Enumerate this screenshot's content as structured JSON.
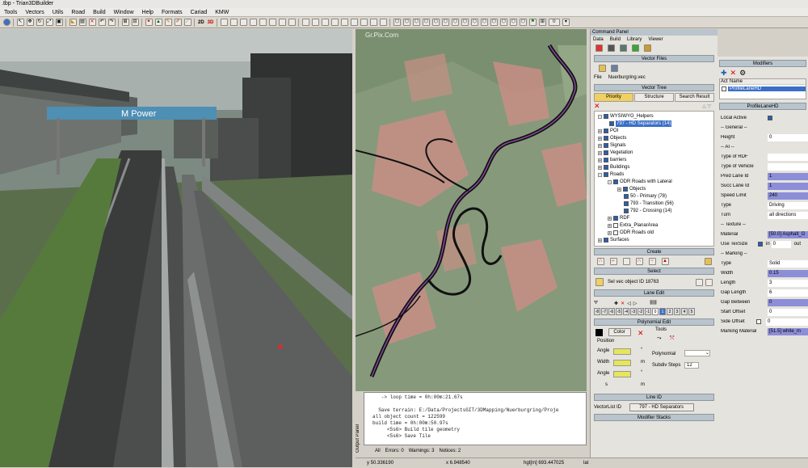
{
  "window": {
    "title": ".tbp - Trian3DBuilder"
  },
  "menu": [
    "Tools",
    "Vectors",
    "Utils",
    "Road",
    "Build",
    "Window",
    "Help",
    "Formats",
    "Cariad",
    "KMW"
  ],
  "toolbar": {
    "btn_2d": "2D",
    "btn_3d": "3D",
    "zoom_value": "0"
  },
  "view3d": {
    "banner": "M Power"
  },
  "map": {
    "corner_label": "Gr.Pix.Corn"
  },
  "output": {
    "lines": [
      "   -> loop time = 0h:00m:21.67s",
      "",
      "  Save terrain: E:/Data/ProjectsGIT/3DMapping/Nuerburgring/Proje",
      "all object count = 122599",
      "build time = 0h:00m:50.97s",
      "     <5s6> Build tile geometry",
      "     <5s6> Save Tile"
    ],
    "panel_label": "Output Panel",
    "tabs": [
      "All",
      "Errors: 0",
      "Warnings: 3",
      "Notices: 2"
    ]
  },
  "status": {
    "y": "y 50.336190",
    "x": "x 6.948540",
    "hgt": "hgt[m] 693.447025",
    "tail": "lat"
  },
  "command_panel": {
    "title": "Command Panel",
    "tabs": [
      "Data",
      "Build",
      "Library",
      "Viewer"
    ],
    "vector_files": {
      "title": "Vector Files",
      "file_label": "File",
      "file_name": "Nuerburgring.vec"
    },
    "vector_tree": {
      "title": "Vector Tree",
      "tabs": [
        "Priority",
        "Structure",
        "Search Result"
      ],
      "items": [
        {
          "label": "WYSIWYG_Helpers",
          "level": 1
        },
        {
          "label": "797 - HD Separators (14)",
          "level": 2,
          "selected": true
        },
        {
          "label": "POI",
          "level": 1
        },
        {
          "label": "Objects",
          "level": 1
        },
        {
          "label": "Signals",
          "level": 1
        },
        {
          "label": "Vegetation",
          "level": 1
        },
        {
          "label": "barriers",
          "level": 1
        },
        {
          "label": "Buildings",
          "level": 1
        },
        {
          "label": "Roads",
          "level": 1
        },
        {
          "label": "ODR Roads with Lateral",
          "level": 2
        },
        {
          "label": "Objects",
          "level": 3
        },
        {
          "label": "50 - Primary (78)",
          "level": 3
        },
        {
          "label": "793 - Transition (56)",
          "level": 3
        },
        {
          "label": "792 - Crossing (14)",
          "level": 3
        },
        {
          "label": "RDF",
          "level": 2
        },
        {
          "label": "Extra_PlanarArea",
          "level": 2
        },
        {
          "label": "ODR Roads old",
          "level": 2
        },
        {
          "label": "Surfaces",
          "level": 1
        }
      ]
    },
    "create": {
      "title": "Create"
    },
    "select": {
      "title": "Select",
      "text": "Sel vec object ID 18763"
    },
    "lane_edit": {
      "title": "Lane Edit",
      "lanes": [
        "-8",
        "-7",
        "-6",
        "-5",
        "-4",
        "-3",
        "-2",
        "-1",
        "0",
        "1",
        "2",
        "3",
        "4",
        "5"
      ],
      "active_lane": "1"
    },
    "polynomial_edit": {
      "title": "Polynomial Edit",
      "color_label": "Color",
      "tools_label": "Tools",
      "position_label": "Position",
      "angle_label": "Angle",
      "width_label": "Width",
      "s_label": "s",
      "unit_deg": "°",
      "unit_m": "m",
      "polynomial_label": "Polynomial",
      "subdiv_label": "Subdiv Steps",
      "subdiv_value": "12"
    },
    "line_id": {
      "title": "Line ID",
      "label": "VectorList ID",
      "value": "797 - HD Separators"
    },
    "modifier_stacks": {
      "title": "Modifier Stacks"
    }
  },
  "modifiers": {
    "title": "Modifiers",
    "col_act": "Act",
    "col_name": "Name",
    "item": "ProfileLaneHD",
    "profile_title": "ProfileLaneHD",
    "props": [
      {
        "label": "Local Active",
        "value": "",
        "type": "check"
      },
      {
        "label": "-- General --",
        "value": "",
        "type": "header"
      },
      {
        "label": "Height",
        "value": "0",
        "type": "w"
      },
      {
        "label": "-- AI --",
        "value": "",
        "type": "header"
      },
      {
        "label": "Type of RDF",
        "value": "",
        "type": "w"
      },
      {
        "label": "Type of Vehicle",
        "value": "",
        "type": "w"
      },
      {
        "label": "Pred Lane Id",
        "value": "1",
        "type": "b"
      },
      {
        "label": "Succ Lane Id",
        "value": "1",
        "type": "b"
      },
      {
        "label": "Speed Limit",
        "value": "240",
        "type": "b"
      },
      {
        "label": "Type",
        "value": "Driving",
        "type": "w"
      },
      {
        "label": "Turn",
        "value": "all directions",
        "type": "w"
      },
      {
        "label": "-- Texture --",
        "value": "",
        "type": "header"
      },
      {
        "label": "Material",
        "value": "[50.0] Asphalt_G",
        "type": "b"
      },
      {
        "label": "Use TexSize",
        "value": "0",
        "type": "tex"
      },
      {
        "label": "-- Marking --",
        "value": "",
        "type": "header"
      },
      {
        "label": "Type",
        "value": "Solid",
        "type": "w"
      },
      {
        "label": "Width",
        "value": "0.15",
        "type": "b"
      },
      {
        "label": "Length",
        "value": "3",
        "type": "w"
      },
      {
        "label": "Gap Length",
        "value": "6",
        "type": "w"
      },
      {
        "label": "Gap Between",
        "value": "0",
        "type": "b"
      },
      {
        "label": "Start Offset",
        "value": "0",
        "type": "w"
      },
      {
        "label": "Side Offset",
        "value": "0",
        "type": "side"
      },
      {
        "label": "Marking Material",
        "value": "[51.5] white_m",
        "type": "b"
      }
    ],
    "tex_in": "in",
    "tex_out": "out"
  },
  "colors": {
    "accent_blue": "#2b5fae",
    "selected": "#3b6fc7",
    "field_blue": "#8c8ed8",
    "swatch_yellow": "#e6e65a"
  }
}
